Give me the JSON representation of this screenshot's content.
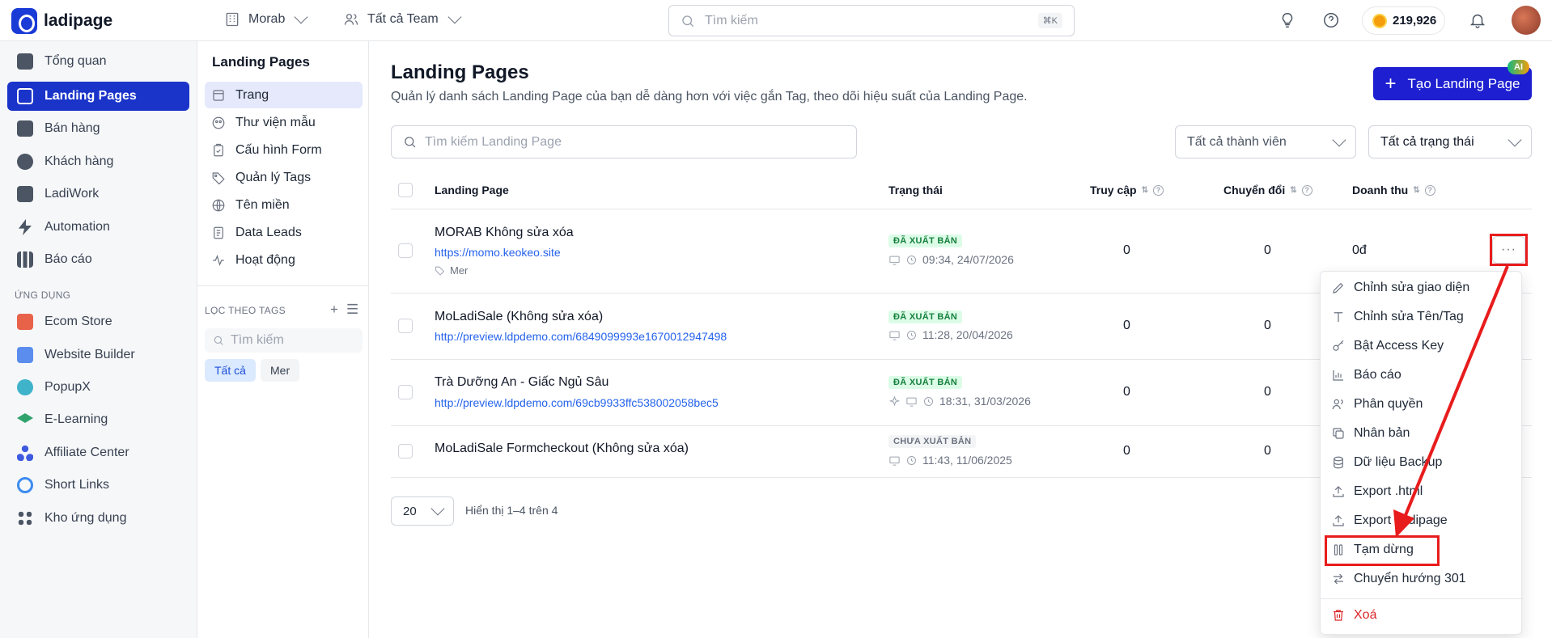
{
  "brand": {
    "name": "ladipage",
    "color": "#1a3bd6"
  },
  "topbar": {
    "workspace": "Morab",
    "team": "Tất cả Team",
    "search_placeholder": "Tìm kiếm",
    "shortcut": "⌘K",
    "credits": "219,926"
  },
  "sidebar": {
    "items": [
      {
        "label": "Tổng quan",
        "icon": "dashboard-icon"
      },
      {
        "label": "Landing Pages",
        "icon": "layout-icon",
        "active": true
      },
      {
        "label": "Bán hàng",
        "icon": "cart-icon"
      },
      {
        "label": "Khách hàng",
        "icon": "users-icon"
      },
      {
        "label": "LadiWork",
        "icon": "briefcase-icon"
      },
      {
        "label": "Automation",
        "icon": "bolt-icon"
      },
      {
        "label": "Báo cáo",
        "icon": "bar-chart-icon"
      }
    ],
    "section_label": "ỨNG DỤNG",
    "apps": [
      {
        "label": "Ecom Store",
        "icon": "store-icon"
      },
      {
        "label": "Website Builder",
        "icon": "website-icon"
      },
      {
        "label": "PopupX",
        "icon": "popup-icon"
      },
      {
        "label": "E-Learning",
        "icon": "graduation-icon"
      },
      {
        "label": "Affiliate Center",
        "icon": "affiliate-icon"
      },
      {
        "label": "Short Links",
        "icon": "link-icon"
      },
      {
        "label": "Kho ứng dụng",
        "icon": "apps-icon"
      }
    ]
  },
  "subnav": {
    "title": "Landing Pages",
    "items": [
      {
        "label": "Trang",
        "icon": "page-icon",
        "active": true
      },
      {
        "label": "Thư viện mẫu",
        "icon": "template-icon"
      },
      {
        "label": "Cấu hình Form",
        "icon": "form-icon"
      },
      {
        "label": "Quản lý Tags",
        "icon": "tag-icon"
      },
      {
        "label": "Tên miền",
        "icon": "globe-icon"
      },
      {
        "label": "Data Leads",
        "icon": "document-icon"
      },
      {
        "label": "Hoạt động",
        "icon": "activity-icon"
      }
    ],
    "tags_header": "LỌC THEO TAGS",
    "tag_search_placeholder": "Tìm kiếm",
    "chips": [
      "Tất cả",
      "Mer"
    ]
  },
  "main": {
    "title": "Landing Pages",
    "description": "Quản lý danh sách Landing Page của bạn dễ dàng hơn với việc gắn Tag, theo dõi hiệu suất của Landing Page.",
    "create_button": "Tạo Landing Page",
    "ai_badge": "AI",
    "search_placeholder": "Tìm kiếm Landing Page",
    "filter_members": "Tất cả thành viên",
    "filter_status": "Tất cả trạng thái",
    "columns": {
      "name": "Landing Page",
      "status": "Trạng thái",
      "visits": "Truy cập",
      "conversions": "Chuyển đổi",
      "revenue": "Doanh thu"
    },
    "rows": [
      {
        "name": "MORAB Không sửa xóa",
        "url": "https://momo.keokeo.site",
        "tag": "Mer",
        "status": "ĐÃ XUẤT BẢN",
        "time": "09:34, 24/07/2026",
        "visits": "0",
        "conversions": "0",
        "revenue": "0đ"
      },
      {
        "name": "MoLadiSale (Không sửa xóa)",
        "url": "http://preview.ldpdemo.com/6849099993e1670012947498",
        "status": "ĐÃ XUẤT BẢN",
        "time": "11:28, 20/04/2026",
        "visits": "0",
        "conversions": "0"
      },
      {
        "name": "Trà Dưỡng An - Giấc Ngủ Sâu",
        "url": "http://preview.ldpdemo.com/69cb9933ffc538002058bec5",
        "status": "ĐÃ XUẤT BẢN",
        "time": "18:31, 31/03/2026",
        "visits": "0",
        "conversions": "0"
      },
      {
        "name": "MoLadiSale Formcheckout (Không sửa xóa)",
        "status": "CHƯA XUẤT BẢN",
        "time": "11:43, 11/06/2025",
        "visits": "0",
        "conversions": "0"
      }
    ],
    "page_size": "20",
    "pagination_info": "Hiển thị 1–4 trên 4",
    "more_label": "···"
  },
  "menu": {
    "items": [
      {
        "label": "Chỉnh sửa giao diện",
        "icon": "pencil-icon"
      },
      {
        "label": "Chỉnh sửa Tên/Tag",
        "icon": "text-icon"
      },
      {
        "label": "Bật Access Key",
        "icon": "key-icon"
      },
      {
        "label": "Báo cáo",
        "icon": "report-icon"
      },
      {
        "label": "Phân quyền",
        "icon": "permission-icon"
      },
      {
        "label": "Nhân bản",
        "icon": "duplicate-icon"
      },
      {
        "label": "Dữ liệu Backup",
        "icon": "database-icon"
      },
      {
        "label": "Export .html",
        "icon": "upload-icon"
      },
      {
        "label": "Export .ladipage",
        "icon": "upload-icon"
      },
      {
        "label": "Tạm dừng",
        "icon": "pause-icon"
      },
      {
        "label": "Chuyển hướng 301",
        "icon": "redirect-icon"
      }
    ],
    "delete": "Xoá"
  },
  "colors": {
    "accent": "#1a34c9",
    "primary_button": "#1d1fd0",
    "highlight": "#e81c1c",
    "published": "#15803d",
    "danger": "#dc2626"
  }
}
